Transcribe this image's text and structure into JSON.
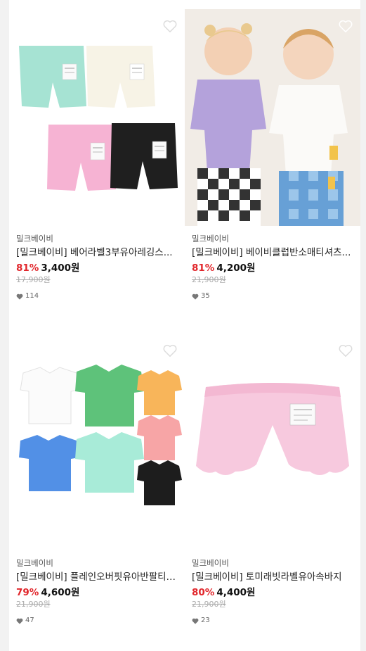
{
  "products": [
    {
      "brand": "밀크베이비",
      "name": "[밀크베이비] 베어라벨3부유아레깅스...",
      "discount": "81%",
      "price": "3,400원",
      "original_price": "17,900원",
      "likes": "114",
      "image_icon": "shorts-four-colors-image"
    },
    {
      "brand": "밀크베이비",
      "name": "[밀크베이비] 베이비클럽반소매티셔츠...",
      "discount": "81%",
      "price": "4,200원",
      "original_price": "21,900원",
      "likes": "35",
      "image_icon": "toddlers-photo-image"
    },
    {
      "brand": "밀크베이비",
      "name": "[밀크베이비] 플레인오버핏유아반팔티셔...",
      "discount": "79%",
      "price": "4,600원",
      "original_price": "21,900원",
      "likes": "47",
      "image_icon": "tshirts-six-colors-image"
    },
    {
      "brand": "밀크베이비",
      "name": "[밀크베이비] 토미래빗라벨유아속바지",
      "discount": "80%",
      "price": "4,400원",
      "original_price": "21,900원",
      "likes": "23",
      "image_icon": "pink-bloomers-image"
    }
  ],
  "colors": {
    "discount": "#e1262b",
    "background": "#f2f2f2",
    "card": "#ffffff"
  }
}
